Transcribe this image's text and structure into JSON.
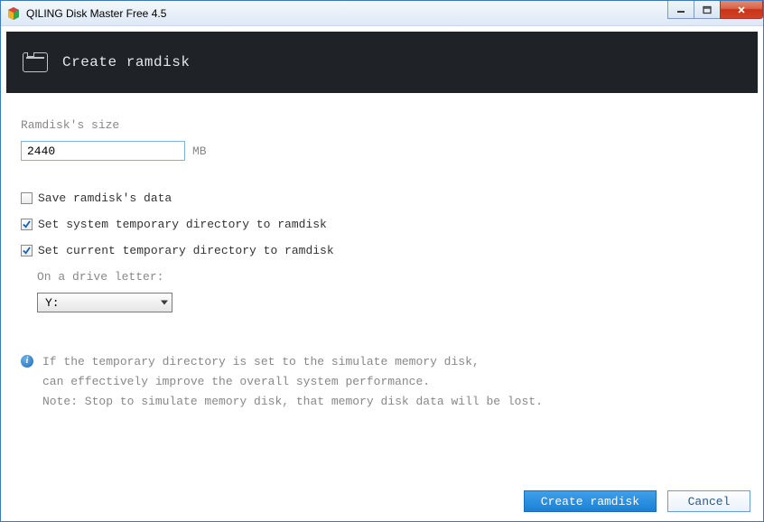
{
  "window": {
    "title": "QILING Disk Master Free 4.5"
  },
  "banner": {
    "title": "Create ramdisk"
  },
  "form": {
    "size_label": "Ramdisk's size",
    "size_value": "2440",
    "size_unit": "MB",
    "checks": [
      {
        "label": "Save ramdisk's data",
        "checked": false
      },
      {
        "label": "Set system temporary directory to ramdisk",
        "checked": true
      },
      {
        "label": "Set current temporary directory to ramdisk",
        "checked": true
      }
    ],
    "drive": {
      "label": "On a drive letter:",
      "selected": "Y:"
    }
  },
  "info": {
    "line1": "If the temporary directory is set to the simulate memory disk,",
    "line2": "can effectively improve the overall system performance.",
    "line3": "Note: Stop to simulate memory disk, that memory disk data will be lost."
  },
  "footer": {
    "primary": "Create ramdisk",
    "secondary": "Cancel"
  }
}
